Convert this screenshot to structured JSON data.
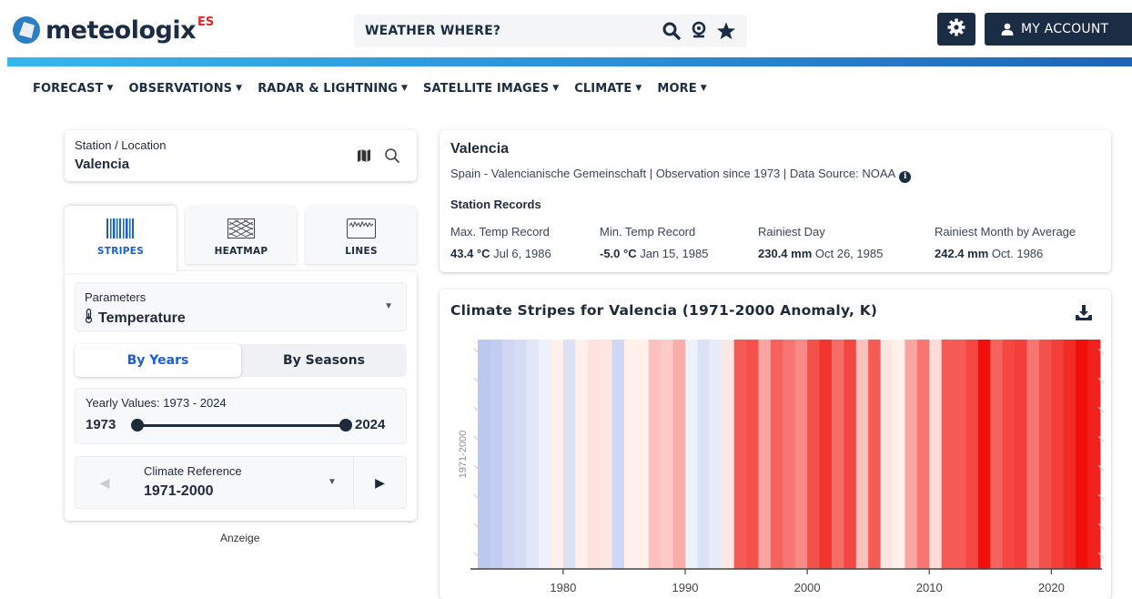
{
  "header": {
    "logo_text": "meteologix",
    "logo_suffix": "ES",
    "search_label": "WEATHER WHERE?",
    "account_label": "MY ACCOUNT",
    "icons": [
      "search-icon",
      "location-pin-icon",
      "star-icon",
      "gear-icon",
      "user-icon"
    ]
  },
  "colors": {
    "brand_dark": "#1b2d44",
    "accent_blue": "#1a5fd0",
    "accent_bar_start": "#36b6ee",
    "accent_bar_end": "#1e64b8"
  },
  "nav": {
    "items": [
      {
        "label": "FORECAST"
      },
      {
        "label": "OBSERVATIONS"
      },
      {
        "label": "RADAR & LIGHTNING"
      },
      {
        "label": "SATELLITE IMAGES"
      },
      {
        "label": "CLIMATE"
      },
      {
        "label": "MORE"
      }
    ]
  },
  "station": {
    "label": "Station / Location",
    "value": "Valencia"
  },
  "tabs": [
    {
      "label": "STRIPES",
      "active": true
    },
    {
      "label": "HEATMAP",
      "active": false
    },
    {
      "label": "LINES",
      "active": false
    }
  ],
  "params": {
    "label": "Parameters",
    "value": "Temperature"
  },
  "segment": {
    "years": "By Years",
    "seasons": "By Seasons",
    "selected": "By Years"
  },
  "yearly": {
    "label": "Yearly Values: 1973 - 2024",
    "start": "1973",
    "end": "2024"
  },
  "reference": {
    "label": "Climate Reference",
    "value": "1971-2000"
  },
  "ad_label": "Anzeige",
  "info": {
    "title": "Valencia",
    "subtitle": "Spain - Valencianische Gemeinschaft | Observation since 1973 | Data Source: NOAA",
    "records_title": "Station Records",
    "records": [
      {
        "label": "Max. Temp Record",
        "value": "43.4 °C",
        "date": "Jul 6, 1986"
      },
      {
        "label": "Min. Temp Record",
        "value": "-5.0 °C",
        "date": "Jan 15, 1985"
      },
      {
        "label": "Rainiest Day",
        "value": "230.4 mm",
        "date": "Oct 26, 1985"
      },
      {
        "label": "Rainiest Month by Average",
        "value": "242.4 mm",
        "date": "Oct. 1986"
      }
    ]
  },
  "chart_data": {
    "type": "heatmap",
    "title": "Climate Stripes for Valencia (1971-2000 Anomaly, K)",
    "ylabel": "1971-2000",
    "xlim": [
      1973,
      2024
    ],
    "x_ticks": [
      1980,
      1990,
      2000,
      2010,
      2020
    ],
    "grid": false,
    "legend": "none",
    "years": [
      1973,
      1974,
      1975,
      1976,
      1977,
      1978,
      1979,
      1980,
      1981,
      1982,
      1983,
      1984,
      1985,
      1986,
      1987,
      1988,
      1989,
      1990,
      1991,
      1992,
      1993,
      1994,
      1995,
      1996,
      1997,
      1998,
      1999,
      2000,
      2001,
      2002,
      2003,
      2004,
      2005,
      2006,
      2007,
      2008,
      2009,
      2010,
      2011,
      2012,
      2013,
      2014,
      2015,
      2016,
      2017,
      2018,
      2019,
      2020,
      2021,
      2022,
      2023
    ],
    "anomalies": [
      -0.9,
      -0.8,
      -0.6,
      -0.5,
      -0.3,
      -0.1,
      0.0,
      -0.4,
      0.0,
      0.15,
      0.1,
      -0.6,
      0.0,
      0.0,
      0.5,
      0.4,
      0.7,
      -0.1,
      -0.4,
      -0.2,
      0.1,
      1.6,
      1.7,
      0.8,
      1.5,
      1.3,
      1.1,
      1.7,
      2.0,
      1.4,
      1.8,
      0.5,
      1.6,
      0.1,
      0.0,
      0.8,
      1.3,
      0.2,
      1.6,
      1.6,
      1.8,
      2.4,
      1.5,
      1.8,
      1.9,
      1.3,
      1.7,
      1.9,
      2.1,
      2.4,
      2.2
    ]
  }
}
